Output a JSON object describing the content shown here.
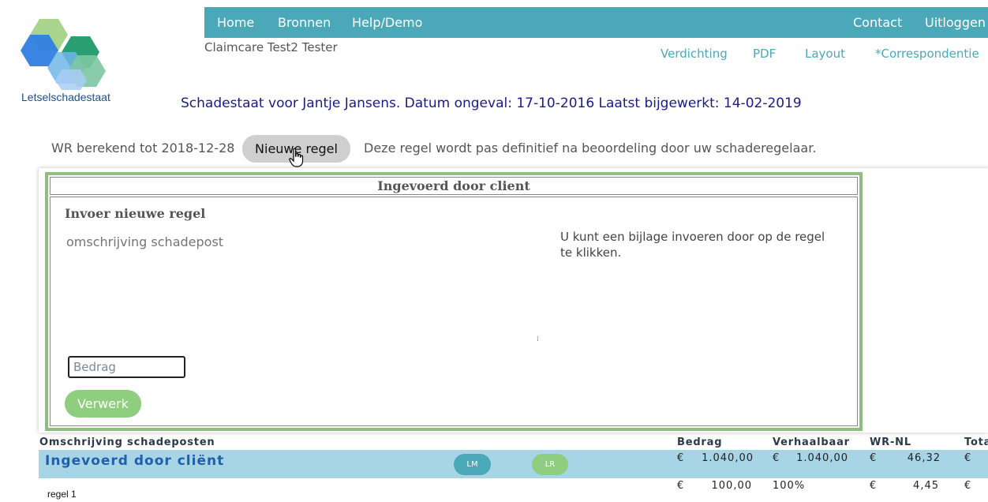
{
  "brand": {
    "logo_text": "Letselschadestaat"
  },
  "nav": {
    "home": "Home",
    "bronnen": "Bronnen",
    "help": "Help/Demo",
    "contact": "Contact",
    "logout": "Uitloggen"
  },
  "user": {
    "name": "Claimcare Test2 Tester"
  },
  "subnav": {
    "verdichting": "Verdichting",
    "pdf": "PDF",
    "layout": "Layout",
    "correspondentie": "*Correspondentie"
  },
  "headline": "Schadestaat voor Jantje Jansens. Datum ongeval: 17-10-2016 Laatst bijgewerkt: 14-02-2019",
  "toolbar": {
    "wr_label": "WR berekend tot 2018-12-28",
    "new_rule_button": "Nieuwe regel",
    "notice": "Deze regel wordt pas definitief na beoordeling door uw schaderegelaar."
  },
  "panel": {
    "header": "Ingevoerd door client",
    "form_title": "Invoer nieuwe regel",
    "description_placeholder": "omschrijving schadepost",
    "hint": "U kunt een bijlage invoeren door op de regel te klikken.",
    "amount_placeholder": "Bedrag",
    "process_button": "Verwerk"
  },
  "table": {
    "headers": {
      "description": "Omschrijving schadeposten",
      "amount": "Bedrag",
      "recoverable": "Verhaalbaar",
      "wr_nl": "WR-NL",
      "total": "Tota"
    },
    "group": {
      "title": "Ingevoerd door cliënt",
      "pill_lm": "LM",
      "pill_lr": "LR",
      "amount_currency": "€",
      "amount": "1.040,00",
      "recoverable_currency": "€",
      "recoverable": "1.040,00",
      "wr_currency": "€",
      "wr": "46,32",
      "total_currency": "€"
    },
    "rows": [
      {
        "label": "regel 1",
        "amount_currency": "€",
        "amount": "100,00",
        "recoverable": "100%",
        "wr_currency": "€",
        "wr": "4,45",
        "total_currency": "€"
      }
    ]
  },
  "colors": {
    "nav_bg": "#4aa8b8",
    "panel_border": "#8fbc7f",
    "group_row_bg": "#a8d5e5",
    "process_button": "#8fce7e",
    "headline": "#1a1a8c"
  }
}
